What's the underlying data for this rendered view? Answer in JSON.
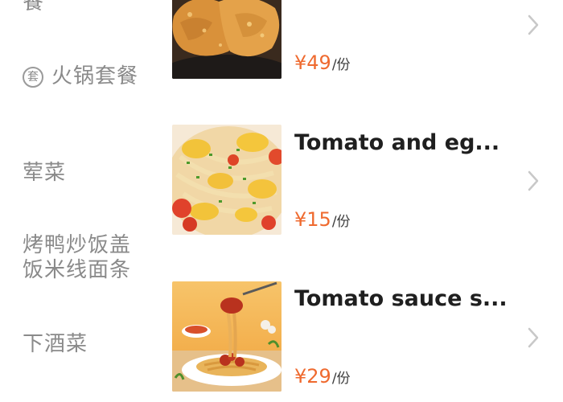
{
  "sidebar": {
    "categories": [
      {
        "label": "餐"
      },
      {
        "tag": "套",
        "label": "火锅套餐"
      },
      {
        "label": "荤菜"
      },
      {
        "label": "烤鸭炒饭盖饭米线面条"
      },
      {
        "label": "下酒菜"
      }
    ]
  },
  "dishes": [
    {
      "image": "fried-chicken-cutlet",
      "price": "¥49",
      "unit": "/份"
    },
    {
      "image": "tomato-egg-noodles",
      "name": "Tomato and eg...",
      "price": "¥15",
      "unit": "/份"
    },
    {
      "image": "tomato-sauce-spaghetti",
      "name": "Tomato sauce s...",
      "price": "¥29",
      "unit": "/份"
    }
  ],
  "icons": {
    "tag": "set-meal-tag-icon",
    "chevron": "chevron-right-icon"
  },
  "colors": {
    "price": "#ef6a2f",
    "category_text": "#8a8a8a",
    "dish_name": "#1f1f1f",
    "chevron": "#c8c8c8"
  }
}
